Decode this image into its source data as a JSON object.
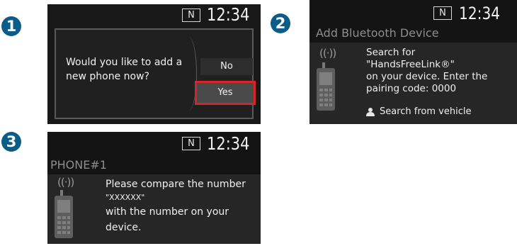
{
  "steps": [
    "1",
    "2",
    "3"
  ],
  "screen1": {
    "gear": "N",
    "time": "12:34",
    "prompt": "Would you like to add a new phone now?",
    "options": {
      "no": "No",
      "yes": "Yes"
    },
    "selected_option": "Yes",
    "highlight_color": "#d9232a"
  },
  "screen2": {
    "gear": "N",
    "time": "12:34",
    "title": "Add Bluetooth Device",
    "instructions": {
      "line1": "Search for",
      "line2": "\"HandsFreeLink®\"",
      "line3": "on your device. Enter the",
      "line4": "pairing code: 0000"
    },
    "search_vehicle_label": "Search from vehicle"
  },
  "screen3": {
    "gear": "N",
    "time": "12:34",
    "title": "PHONE#1",
    "message": {
      "line1": "Please compare the number",
      "line2": "\"XXXXXX\"",
      "line3": "with the number on your",
      "line4": "device."
    }
  },
  "icons": {
    "phone": "mobile-phone-icon",
    "signal": "bluetooth-signal-waves-icon",
    "person_search": "person-search-icon"
  },
  "colors": {
    "step_badge": "#0b5c86",
    "screen_bg": "#1c1c1c",
    "title_gray": "#8d8d8d"
  }
}
